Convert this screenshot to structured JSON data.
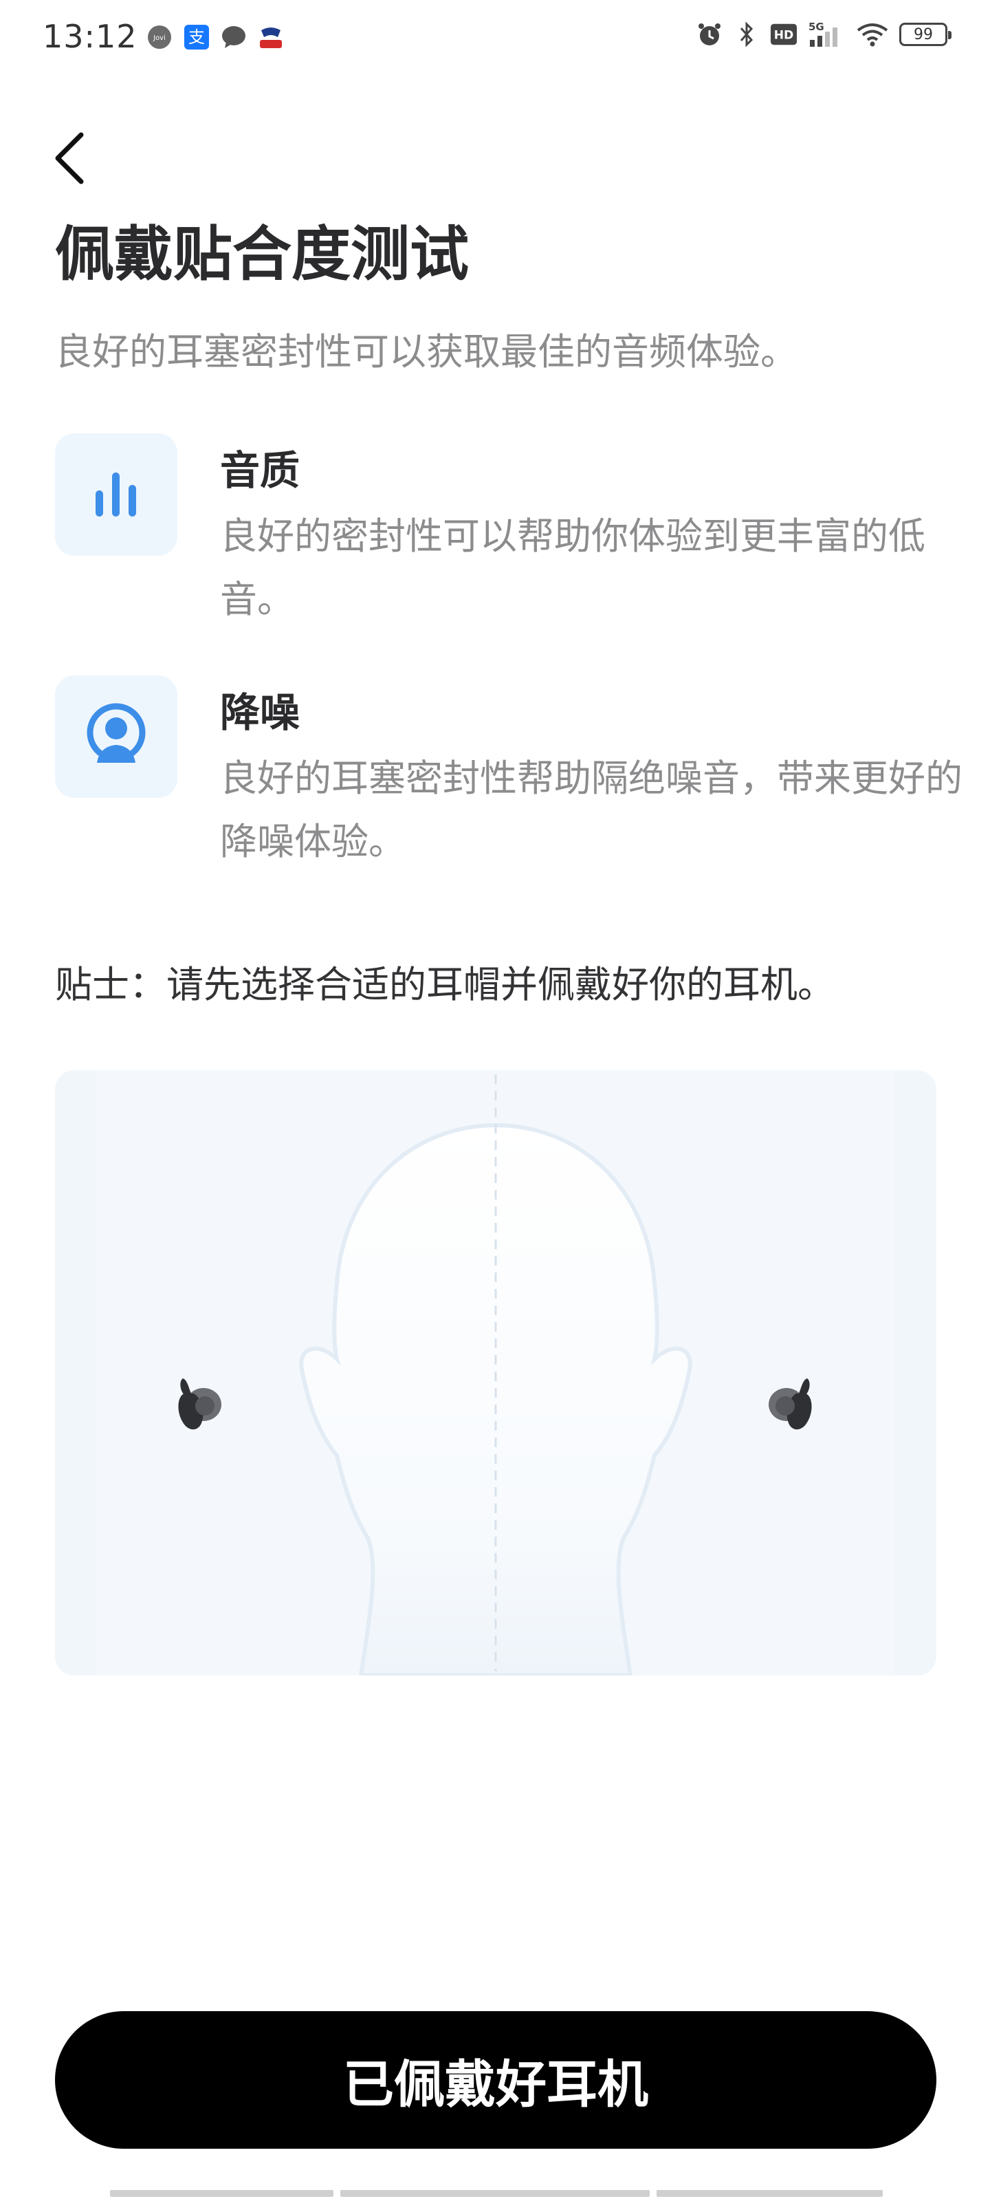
{
  "status_bar": {
    "time": "13:12",
    "left_icons": [
      "jovi-icon",
      "alipay-icon",
      "message-icon",
      "app-icon"
    ],
    "right_icons": [
      "alarm-icon",
      "bluetooth-icon",
      "hd-icon",
      "signal-5g-icon",
      "wifi-icon"
    ],
    "network": "5G",
    "hd_label": "HD",
    "battery": "99"
  },
  "header": {
    "title": "佩戴贴合度测试",
    "subtitle": "良好的耳塞密封性可以获取最佳的音频体验。"
  },
  "features": [
    {
      "icon": "equalizer-icon",
      "title": "音质",
      "description": "良好的密封性可以帮助你体验到更丰富的低音。"
    },
    {
      "icon": "noise-cancel-icon",
      "title": "降噪",
      "description": "良好的耳塞密封性帮助隔绝噪音，带来更好的降噪体验。"
    }
  ],
  "tip": "贴士：请先选择合适的耳帽并佩戴好你的耳机。",
  "illustration": {
    "icon": "head-with-earbuds-illustration"
  },
  "confirm_button": {
    "label": "已佩戴好耳机"
  },
  "colors": {
    "accent_blue": "#3d8ee8",
    "icon_bg": "#eef6fd",
    "button_bg": "#000000"
  }
}
